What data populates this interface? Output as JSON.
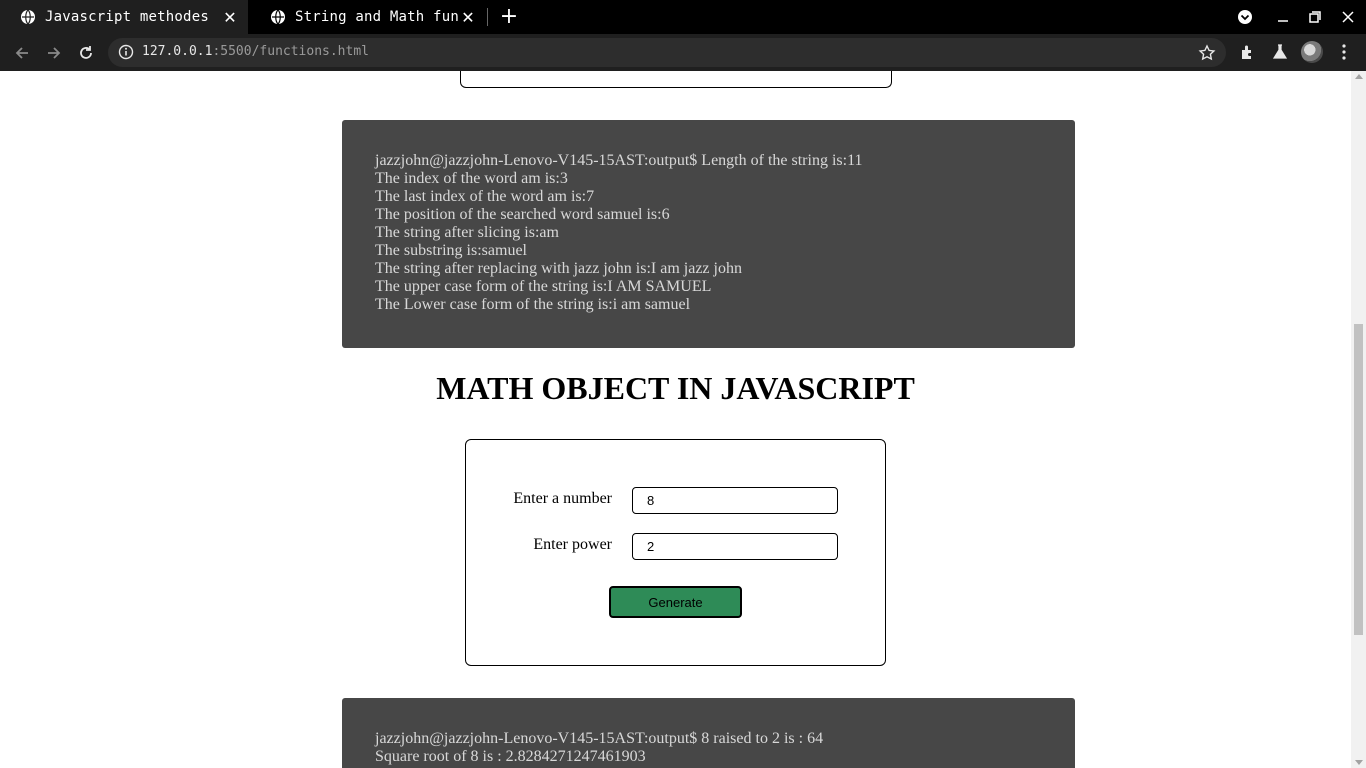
{
  "browser": {
    "tabs": [
      {
        "title": "Javascript methodes",
        "active": true
      },
      {
        "title": "String and Math functio",
        "active": false
      }
    ],
    "url_host": "127.0.0.1",
    "url_rest": ":5500/functions.html",
    "colors": {
      "tabstrip": "#000000",
      "toolbar": "#1f1f1f",
      "omnibox": "#2d2d2d"
    }
  },
  "string_output": {
    "lines": [
      "jazzjohn@jazzjohn-Lenovo-V145-15AST:output$ Length of the string is:11",
      "The index of the word am is:3",
      "The last index of the word am is:7",
      "The position of the searched word samuel is:6",
      "The string after slicing is:am",
      "The substring is:samuel",
      "The string after replacing with jazz john is:I am jazz john",
      "The upper case form of the string is:I AM SAMUEL",
      "The Lower case form of the string is:i am samuel"
    ]
  },
  "math": {
    "title": "MATH OBJECT IN JAVASCRIPT",
    "number_label": "Enter a number",
    "number_value": "8",
    "power_label": "Enter power",
    "power_value": "2",
    "generate_label": "Generate",
    "button_color": "#2e8b57"
  },
  "math_output": {
    "lines": [
      "jazzjohn@jazzjohn-Lenovo-V145-15AST:output$ 8 raised to 2 is : 64",
      "Square root of 8 is : 2.8284271247461903"
    ]
  },
  "console_color": "#474747"
}
